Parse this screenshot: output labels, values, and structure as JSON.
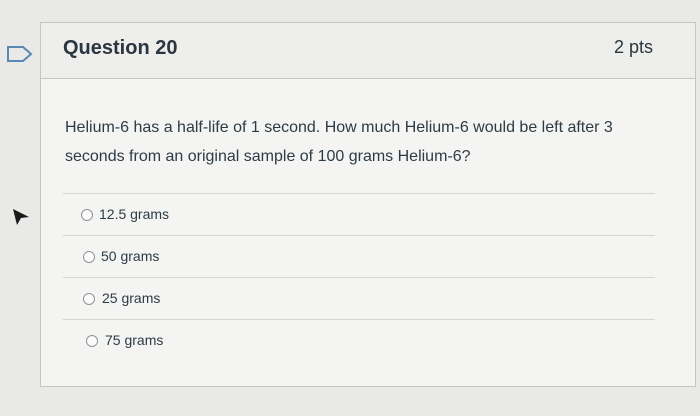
{
  "question": {
    "title": "Question 20",
    "points": "2 pts",
    "text": "Helium-6 has a half-life of 1 second. How much Helium-6 would be left after 3 seconds from an original sample of 100 grams Helium-6?"
  },
  "answers": [
    {
      "label": "12.5 grams",
      "selected": false
    },
    {
      "label": "50 grams",
      "selected": false
    },
    {
      "label": "25 grams",
      "selected": false
    },
    {
      "label": "75 grams",
      "selected": false
    }
  ],
  "icons": {
    "flag": "flag-outline-icon",
    "pointer": "mouse-pointer-icon"
  },
  "colors": {
    "page_bg": "#e9e9e7",
    "card_bg": "#f4f4f2",
    "flag_outline": "#5b87b5",
    "text": "#2d3b45"
  }
}
